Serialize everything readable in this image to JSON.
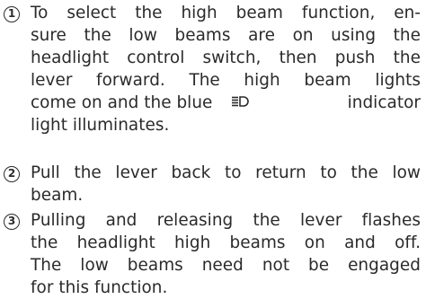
{
  "steps": [
    {
      "number": "1",
      "lines": [
        "To select the high beam function, en-",
        "sure the low beams are on using the",
        "headlight control switch, then push the",
        "lever forward. The high beam lights",
        "come on and the blue",
        "indicator",
        "light illuminates."
      ],
      "icon": "high-beam-indicator-icon"
    },
    {
      "number": "2",
      "lines": [
        "Pull the lever back to return to the low",
        "beam."
      ]
    },
    {
      "number": "3",
      "lines": [
        "Pulling and releasing the lever flashes",
        "the headlight high beams on and off.",
        "The low beams need not be engaged",
        "for this function."
      ]
    }
  ]
}
